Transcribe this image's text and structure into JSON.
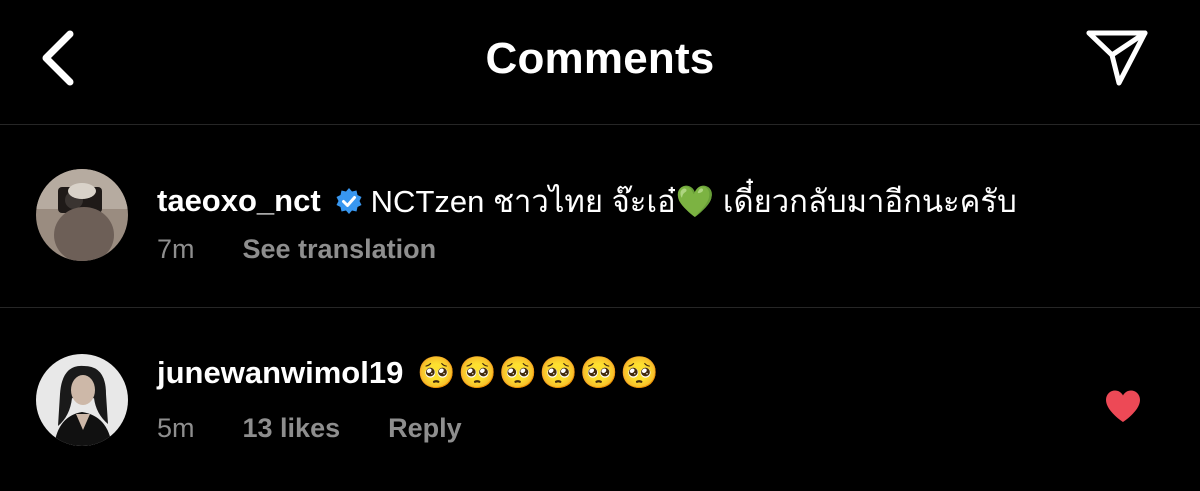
{
  "header": {
    "back_icon": "chevron-left-icon",
    "title": "Comments",
    "share_icon": "paper-plane-icon"
  },
  "comments": [
    {
      "username": "taeoxo_nct",
      "verified": true,
      "text": "NCTzen ชาวไทย จ๊ะเอ๋💚 เดี๋ยวกลับมาอีกนะครับ",
      "time": "7m",
      "action": "See translation"
    },
    {
      "username": "junewanwimol19",
      "verified": false,
      "text": "🥺🥺🥺🥺🥺🥺",
      "time": "5m",
      "likes": "13 likes",
      "action": "Reply",
      "liked": true
    }
  ],
  "colors": {
    "background": "#000000",
    "text": "#ffffff",
    "muted": "#8e8e8e",
    "divider": "#262626",
    "verified": "#3897f0",
    "like": "#ed4956"
  }
}
